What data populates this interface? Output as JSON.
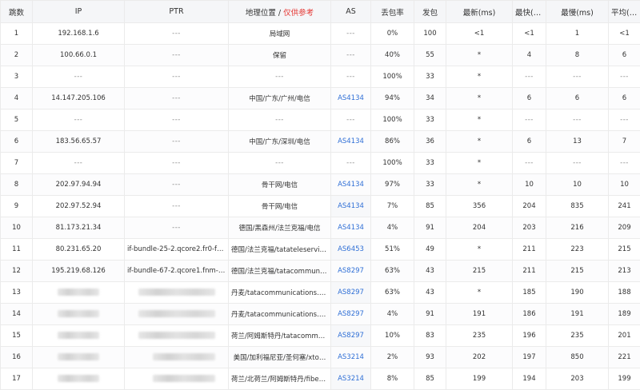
{
  "columns": {
    "hop": "跳数",
    "ip": "IP",
    "ptr": "PTR",
    "geo": "地理位置 /",
    "geo_note": "仅供参考",
    "as": "AS",
    "loss": "丢包率",
    "sent": "发包",
    "last": "最新(ms)",
    "best": "最快(ms)",
    "worst": "最慢(ms)",
    "avg": "平均(ms)"
  },
  "colors": {
    "header_bg": "#f5f6f8",
    "border": "#ebebeb",
    "link": "#2f6fd6",
    "warning": "#e53935"
  },
  "rows": [
    {
      "hop": "1",
      "ip": "192.168.1.6",
      "ptr": "---",
      "geo": "局域网",
      "as": "---",
      "loss": "0%",
      "sent": "100",
      "last": "<1",
      "best": "<1",
      "worst": "1",
      "avg": "<1"
    },
    {
      "hop": "2",
      "ip": "100.66.0.1",
      "ptr": "---",
      "geo": "保留",
      "as": "---",
      "loss": "40%",
      "sent": "55",
      "last": "*",
      "best": "4",
      "worst": "8",
      "avg": "6"
    },
    {
      "hop": "3",
      "ip": "---",
      "ptr": "---",
      "geo": "---",
      "as": "---",
      "loss": "100%",
      "sent": "33",
      "last": "*",
      "best": "---",
      "worst": "---",
      "avg": "---"
    },
    {
      "hop": "4",
      "ip": "14.147.205.106",
      "ptr": "---",
      "geo": "中国/广东/广州/电信",
      "as": "AS4134",
      "loss": "94%",
      "sent": "34",
      "last": "*",
      "best": "6",
      "worst": "6",
      "avg": "6"
    },
    {
      "hop": "5",
      "ip": "---",
      "ptr": "---",
      "geo": "---",
      "as": "---",
      "loss": "100%",
      "sent": "33",
      "last": "*",
      "best": "---",
      "worst": "---",
      "avg": "---"
    },
    {
      "hop": "6",
      "ip": "183.56.65.57",
      "ptr": "---",
      "geo": "中国/广东/深圳/电信",
      "as": "AS4134",
      "loss": "86%",
      "sent": "36",
      "last": "*",
      "best": "6",
      "worst": "13",
      "avg": "7"
    },
    {
      "hop": "7",
      "ip": "---",
      "ptr": "---",
      "geo": "---",
      "as": "---",
      "loss": "100%",
      "sent": "33",
      "last": "*",
      "best": "---",
      "worst": "---",
      "avg": "---"
    },
    {
      "hop": "8",
      "ip": "202.97.94.94",
      "ptr": "---",
      "geo": "骨干网/电信",
      "as": "AS4134",
      "loss": "97%",
      "sent": "33",
      "last": "*",
      "best": "10",
      "worst": "10",
      "avg": "10"
    },
    {
      "hop": "9",
      "ip": "202.97.52.94",
      "ptr": "---",
      "geo": "骨干网/电信",
      "as": "AS4134",
      "loss": "7%",
      "sent": "85",
      "last": "356",
      "best": "204",
      "worst": "835",
      "avg": "241"
    },
    {
      "hop": "10",
      "ip": "81.173.21.34",
      "ptr": "---",
      "geo": "德国/黑森州/法兰克福/电信",
      "as": "AS4134",
      "loss": "4%",
      "sent": "91",
      "last": "204",
      "best": "203",
      "worst": "216",
      "avg": "209"
    },
    {
      "hop": "11",
      "ip": "80.231.65.20",
      "ptr": "if-bundle-25-2.qcore2.fr0-fr…",
      "geo": "德国/法兰克福/tatateleservice…",
      "as": "AS6453",
      "loss": "51%",
      "sent": "49",
      "last": "*",
      "best": "211",
      "worst": "223",
      "avg": "215"
    },
    {
      "hop": "12",
      "ip": "195.219.68.126",
      "ptr": "if-bundle-67-2.qcore1.fnm-f…",
      "geo": "德国/法兰克福/tatacommunic…",
      "as": "AS8297",
      "loss": "63%",
      "sent": "43",
      "last": "215",
      "best": "211",
      "worst": "215",
      "avg": "213"
    },
    {
      "hop": "13",
      "ip": "",
      "ptr": "",
      "geo": "丹麦/tatacommunications.com",
      "as": "AS8297",
      "loss": "63%",
      "sent": "43",
      "last": "*",
      "best": "185",
      "worst": "190",
      "avg": "188"
    },
    {
      "hop": "14",
      "ip": "",
      "ptr": "",
      "geo": "丹麦/tatacommunications.com",
      "as": "AS8297",
      "loss": "4%",
      "sent": "91",
      "last": "191",
      "best": "186",
      "worst": "191",
      "avg": "189"
    },
    {
      "hop": "15",
      "ip": "",
      "ptr": "",
      "geo": "荷兰/阿姆斯特丹/tatacommun…",
      "as": "AS8297",
      "loss": "10%",
      "sent": "83",
      "last": "235",
      "best": "196",
      "worst": "235",
      "avg": "201"
    },
    {
      "hop": "16",
      "ip": "",
      "ptr": "",
      "geo": "美国/加利福尼亚/圣何塞/xto…",
      "as": "AS3214",
      "loss": "2%",
      "sent": "93",
      "last": "202",
      "best": "197",
      "worst": "850",
      "avg": "221"
    },
    {
      "hop": "17",
      "ip": "",
      "ptr": "",
      "geo": "荷兰/北荷兰/阿姆斯特丹/fiber…",
      "as": "AS3214",
      "loss": "8%",
      "sent": "85",
      "last": "199",
      "best": "194",
      "worst": "203",
      "avg": "199"
    }
  ]
}
